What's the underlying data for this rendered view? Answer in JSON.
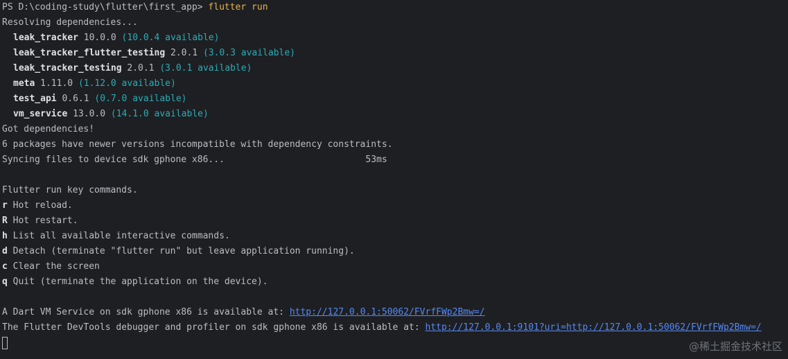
{
  "prompt": {
    "ps": "PS D:\\coding-study\\flutter\\first_app> ",
    "command": "flutter run"
  },
  "resolving": "Resolving dependencies...",
  "packages": [
    {
      "name": "leak_tracker",
      "version": " 10.0.0 ",
      "available": "(10.0.4 available)"
    },
    {
      "name": "leak_tracker_flutter_testing",
      "version": " 2.0.1 ",
      "available": "(3.0.3 available)"
    },
    {
      "name": "leak_tracker_testing",
      "version": " 2.0.1 ",
      "available": "(3.0.1 available)"
    },
    {
      "name": "meta",
      "version": " 1.11.0 ",
      "available": "(1.12.0 available)"
    },
    {
      "name": "test_api",
      "version": " 0.6.1 ",
      "available": "(0.7.0 available)"
    },
    {
      "name": "vm_service",
      "version": " 13.0.0 ",
      "available": "(14.1.0 available)"
    }
  ],
  "got_deps": "Got dependencies!",
  "newer_versions": "6 packages have newer versions incompatible with dependency constraints.",
  "syncing": "Syncing files to device sdk gphone x86...                          53ms",
  "key_commands_title": "Flutter run key commands.",
  "key_commands": [
    {
      "key": "r",
      "desc": " Hot reload."
    },
    {
      "key": "R",
      "desc": " Hot restart."
    },
    {
      "key": "h",
      "desc": " List all available interactive commands."
    },
    {
      "key": "d",
      "desc": " Detach (terminate \"flutter run\" but leave application running)."
    },
    {
      "key": "c",
      "desc": " Clear the screen"
    },
    {
      "key": "q",
      "desc": " Quit (terminate the application on the device)."
    }
  ],
  "vm_service": {
    "text": "A Dart VM Service on sdk gphone x86 is available at: ",
    "url": "http://127.0.0.1:50062/FVrfFWp2Bmw=/"
  },
  "devtools": {
    "text": "The Flutter DevTools debugger and profiler on sdk gphone x86 is available at: ",
    "url": "http://127.0.0.1:9101?uri=http://127.0.0.1:50062/FVrfFWp2Bmw=/"
  },
  "watermark": "@稀土掘金技术社区",
  "colors": {
    "background": "#1e1f22",
    "text": "#bcbec4",
    "command": "#e6b450",
    "available": "#2aacb8",
    "link": "#548af7"
  }
}
